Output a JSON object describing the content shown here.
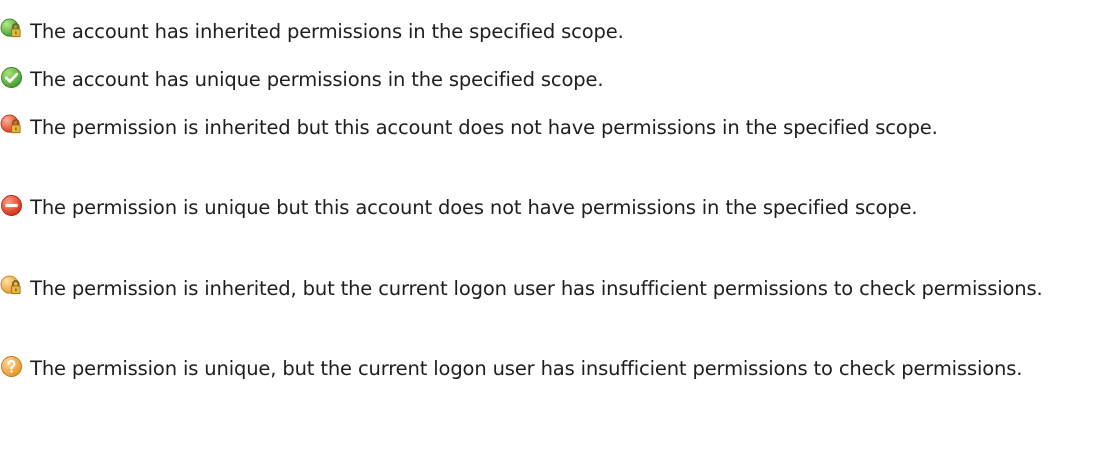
{
  "legend": {
    "items": [
      {
        "icon": "inherited-permission-icon",
        "color": "#4caa36",
        "text": "The account has inherited permissions in the specified scope."
      },
      {
        "icon": "unique-permission-check-icon",
        "color": "#4caa36",
        "text": "The account has unique permissions in the specified scope."
      },
      {
        "icon": "inherited-no-permission-icon",
        "color": "#e0462c",
        "text": "The permission is inherited but this account does not have permissions in the specified scope."
      },
      {
        "icon": "unique-no-permission-icon",
        "color": "#e0462c",
        "text": "The permission is unique but this account does not have permissions in the specified scope."
      },
      {
        "icon": "inherited-insufficient-permission-icon",
        "color": "#f0a030",
        "text": "The permission is inherited, but the current logon user has insufficient permissions to check permissions."
      },
      {
        "icon": "unique-insufficient-permission-question-icon",
        "color": "#f0a030",
        "text": "The permission is unique, but the current logon user has insufficient permissions to check permissions."
      }
    ]
  }
}
